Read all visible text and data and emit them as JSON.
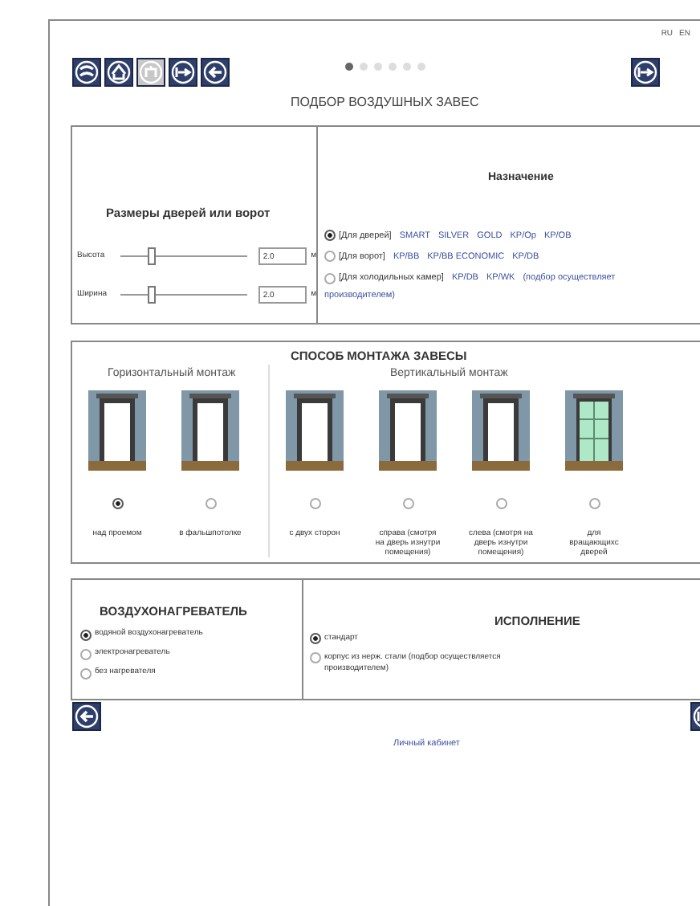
{
  "language_links": [
    "RU",
    "EN"
  ],
  "toolbar": [
    {
      "disabled": false
    },
    {
      "disabled": false
    },
    {
      "disabled": true
    },
    {
      "disabled": false
    },
    {
      "disabled": false
    }
  ],
  "steps": [
    {
      "selected": true
    },
    {
      "selected": false
    },
    {
      "selected": false
    },
    {
      "selected": false
    },
    {
      "selected": false
    },
    {
      "selected": false
    }
  ],
  "title": "ПОДБОР ВОЗДУШНЫХ ЗАВЕС",
  "dimensions": {
    "title": "Размеры дверей или ворот",
    "fields": [
      {
        "label": "Высота",
        "level": 0.25,
        "value": "2.0",
        "unit": "м"
      },
      {
        "label": "Ширина",
        "level": 0.25,
        "value": "2.0",
        "unit": "м"
      }
    ]
  },
  "purpose": {
    "title": "Назначение",
    "options": [
      {
        "selected": true,
        "category": "[Для дверей]",
        "models": [
          "SMART",
          "SILVER",
          "GOLD",
          "KP/Op",
          "KP/OB"
        ]
      },
      {
        "selected": false,
        "category": "[Для ворот]",
        "models": [
          "KP/BB",
          "KP/BB ECONOMIC",
          "KP/DB"
        ]
      },
      {
        "selected": false,
        "category": "[Для холодильных камер]",
        "models": [
          "KP/DB",
          "KP/WK"
        ],
        "note": "(подбор осуществляет",
        "note_continued": "производителем)"
      }
    ]
  },
  "mounting": {
    "title": "СПОСОБ МОНТАЖА ЗАВЕСЫ",
    "groups": [
      {
        "title": "Горизонтальный монтаж",
        "options": [
          {
            "kind": "door",
            "selected": true,
            "label": "над проемом"
          },
          {
            "kind": "door",
            "selected": false,
            "label": "в фальшпотолке"
          }
        ]
      },
      {
        "title": "Вертикальный монтаж",
        "options": [
          {
            "kind": "door",
            "selected": false,
            "label": "с двух сторон"
          },
          {
            "kind": "door",
            "selected": false,
            "label": "справа (смотря\nна дверь изнутри\nпомещения)"
          },
          {
            "kind": "door",
            "selected": false,
            "label": "слева (смотря на\nдверь изнутри\nпомещения)"
          },
          {
            "kind": "glass-door",
            "selected": false,
            "label": "для\nвращающихс\nдверей"
          }
        ]
      }
    ]
  },
  "heater": {
    "title": "ВОЗДУХОНАГРЕВАТЕЛЬ",
    "options": [
      {
        "selected": true,
        "label": "водяной воздухонагреватель"
      },
      {
        "selected": false,
        "label": "электронагреватель"
      },
      {
        "selected": false,
        "label": "без нагревателя"
      }
    ]
  },
  "execution": {
    "title": "ИСПОЛНЕНИЕ",
    "options": [
      {
        "selected": true,
        "label": "стандарт"
      },
      {
        "selected": false,
        "label": "корпус из нерж. стали (подбор осуществляется\nпроизводителем)"
      }
    ]
  },
  "footer_link": "Личный кабинет"
}
